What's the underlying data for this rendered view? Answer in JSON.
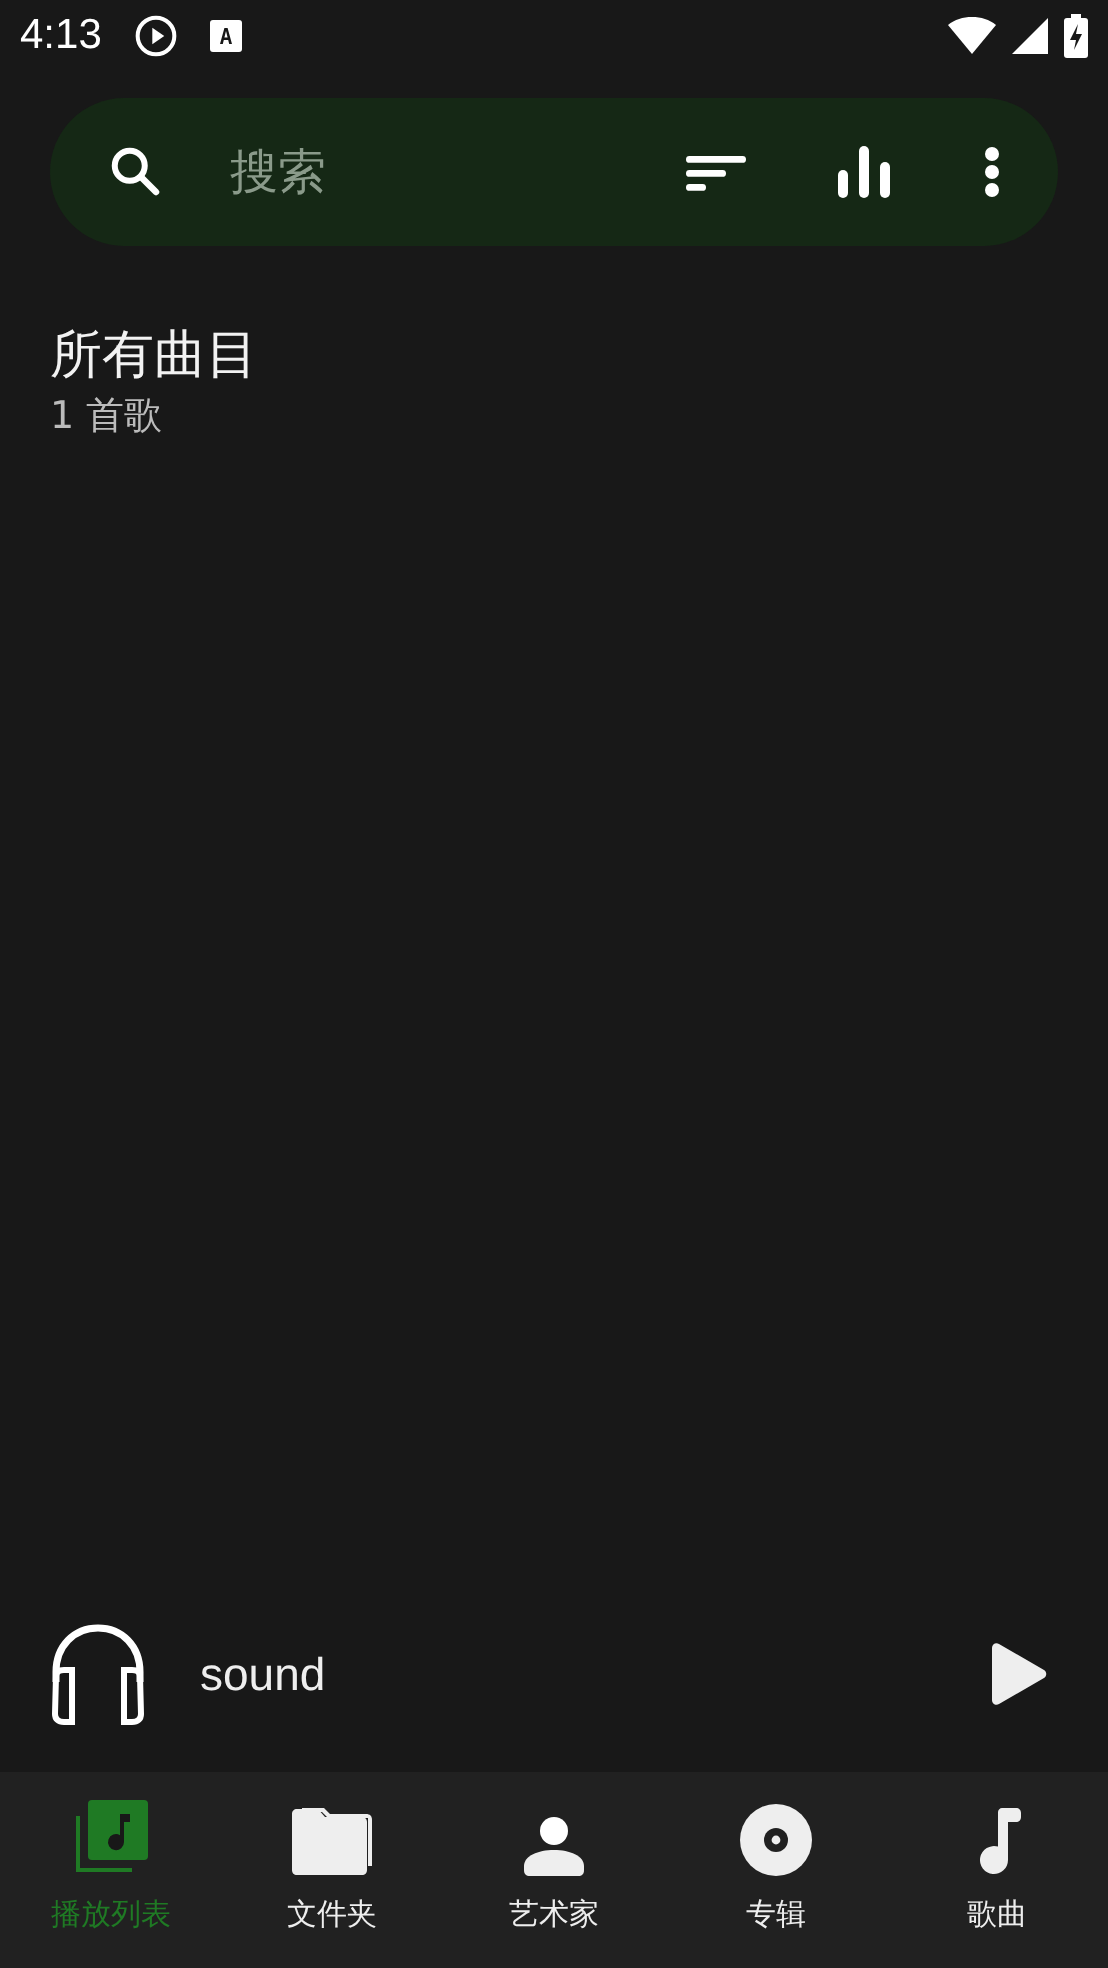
{
  "status_bar": {
    "time": "4:13"
  },
  "search": {
    "placeholder": "搜索"
  },
  "header": {
    "title": "所有曲目",
    "subtitle": "1 首歌"
  },
  "now_playing": {
    "title": "sound"
  },
  "bottom_nav": [
    {
      "label": "播放列表",
      "selected": true
    },
    {
      "label": "文件夹",
      "selected": false
    },
    {
      "label": "艺术家",
      "selected": false
    },
    {
      "label": "专辑",
      "selected": false
    },
    {
      "label": "歌曲",
      "selected": false
    }
  ]
}
